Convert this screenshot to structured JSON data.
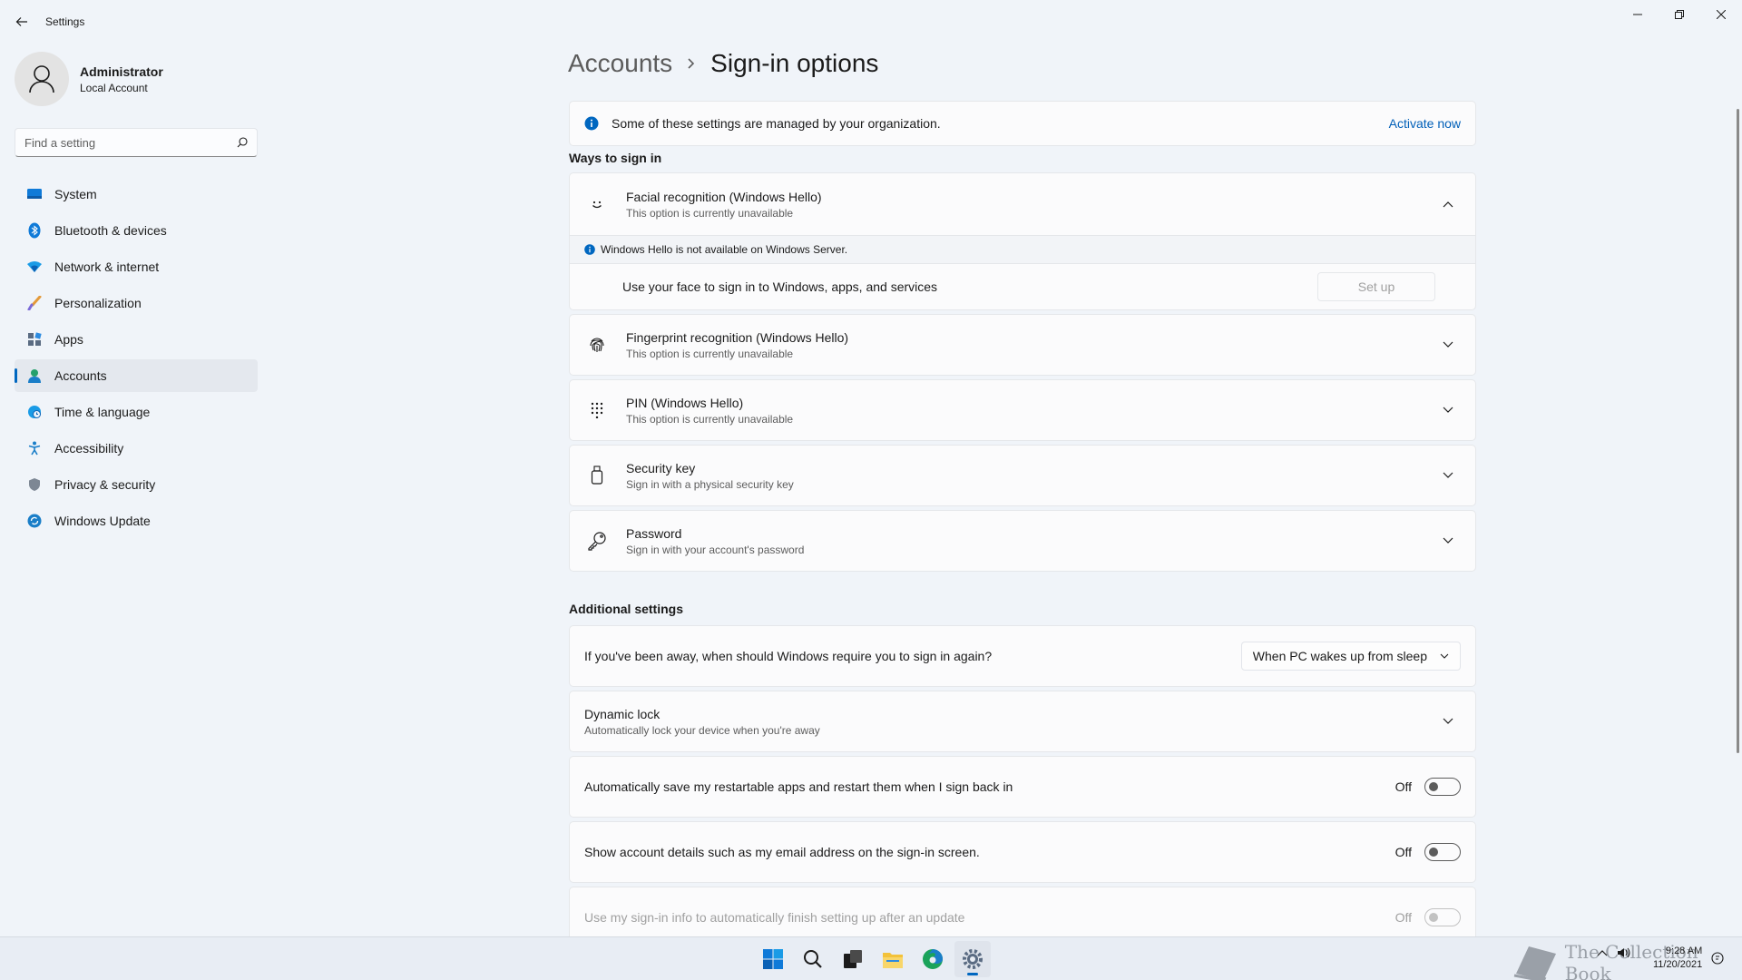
{
  "window": {
    "title": "Settings"
  },
  "profile": {
    "name": "Administrator",
    "account_type": "Local Account"
  },
  "search": {
    "placeholder": "Find a setting"
  },
  "sidebar": {
    "items": [
      {
        "label": "System",
        "icon": "system-icon",
        "active": false
      },
      {
        "label": "Bluetooth & devices",
        "icon": "bluetooth-icon",
        "active": false
      },
      {
        "label": "Network & internet",
        "icon": "wifi-icon",
        "active": false
      },
      {
        "label": "Personalization",
        "icon": "brush-icon",
        "active": false
      },
      {
        "label": "Apps",
        "icon": "apps-icon",
        "active": false
      },
      {
        "label": "Accounts",
        "icon": "person-icon",
        "active": true
      },
      {
        "label": "Time & language",
        "icon": "globe-clock-icon",
        "active": false
      },
      {
        "label": "Accessibility",
        "icon": "accessibility-icon",
        "active": false
      },
      {
        "label": "Privacy & security",
        "icon": "shield-icon",
        "active": false
      },
      {
        "label": "Windows Update",
        "icon": "update-icon",
        "active": false
      }
    ]
  },
  "breadcrumb": {
    "parent": "Accounts",
    "current": "Sign-in options"
  },
  "info_bar": {
    "text": "Some of these settings are managed by your organization.",
    "action": "Activate now"
  },
  "ways": {
    "title": "Ways to sign in",
    "face": {
      "title": "Facial recognition (Windows Hello)",
      "subtitle": "This option is currently unavailable",
      "note": "Windows Hello is not available on Windows Server.",
      "action_text": "Use your face to sign in to Windows, apps, and services",
      "button": "Set up"
    },
    "items": [
      {
        "title": "Fingerprint recognition (Windows Hello)",
        "subtitle": "This option is currently unavailable",
        "icon": "fingerprint-icon"
      },
      {
        "title": "PIN (Windows Hello)",
        "subtitle": "This option is currently unavailable",
        "icon": "keypad-icon"
      },
      {
        "title": "Security key",
        "subtitle": "Sign in with a physical security key",
        "icon": "usb-key-icon"
      },
      {
        "title": "Password",
        "subtitle": "Sign in with your account's password",
        "icon": "key-icon"
      }
    ]
  },
  "additional": {
    "title": "Additional settings",
    "require_signin": {
      "text": "If you've been away, when should Windows require you to sign in again?",
      "selected": "When PC wakes up from sleep"
    },
    "dynamic_lock": {
      "title": "Dynamic lock",
      "subtitle": "Automatically lock your device when you're away"
    },
    "toggles": [
      {
        "text": "Automatically save my restartable apps and restart them when I sign back in",
        "state": "Off",
        "disabled": false
      },
      {
        "text": "Show account details such as my email address on the sign-in screen.",
        "state": "Off",
        "disabled": false
      },
      {
        "text": "Use my sign-in info to automatically finish setting up after an update",
        "state": "Off",
        "disabled": true
      }
    ]
  },
  "taskbar": {
    "apps": [
      "start-icon",
      "search-icon",
      "task-view-icon",
      "file-explorer-icon",
      "edge-icon",
      "settings-icon"
    ],
    "watermark": "The Collection Book",
    "time": "9:28 AM",
    "date": "11/20/2021"
  },
  "colors": {
    "accent": "#0067c0",
    "background": "#f0f4f9",
    "card": "#fbfbfc"
  }
}
